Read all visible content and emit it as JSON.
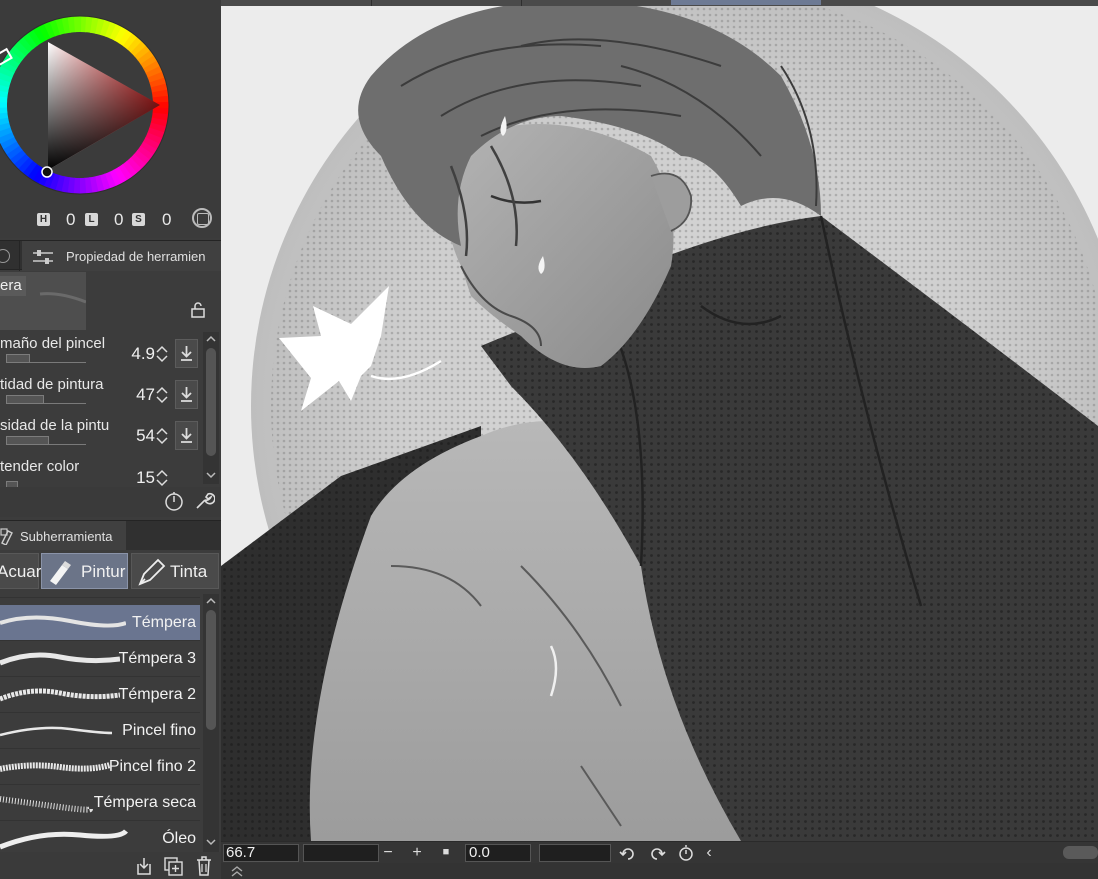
{
  "color_panel": {
    "hue_label": "H",
    "hue_value": "0",
    "lightness_label": "L",
    "lightness_value": "0",
    "saturation_label": "S",
    "saturation_value": "0"
  },
  "tool_property": {
    "tab_label": "Propiedad de herramien",
    "tool_name": "era",
    "properties": [
      {
        "label": "maño del pincel",
        "value": "4.9",
        "fill_fraction": 0.3
      },
      {
        "label": "tidad de pintura",
        "value": "47",
        "fill_fraction": 0.47
      },
      {
        "label": "sidad de la pintu",
        "value": "54",
        "fill_fraction": 0.54
      },
      {
        "label": "tender color",
        "value": "15",
        "fill_fraction": 0.15
      }
    ]
  },
  "subtool": {
    "tab_label": "Subherramienta",
    "groups": [
      {
        "label": "Acuar",
        "icon": "watercolor-icon",
        "active": false
      },
      {
        "label": "Pintur",
        "icon": "paint-tube-icon",
        "active": true
      },
      {
        "label": "Tinta",
        "icon": "ink-pen-icon",
        "active": false
      }
    ],
    "items": [
      {
        "name": "Témpera",
        "active": true
      },
      {
        "name": "Témpera 3",
        "active": false
      },
      {
        "name": "Témpera 2",
        "active": false
      },
      {
        "name": "Pincel fino",
        "active": false
      },
      {
        "name": "Pincel fino 2",
        "active": false
      },
      {
        "name": "Témpera seca",
        "active": false
      },
      {
        "name": "Óleo",
        "active": false
      }
    ]
  },
  "status_bar": {
    "zoom": "66.7",
    "zoom_out_symbol": "−",
    "zoom_in_symbol": "+",
    "fit_symbol": "■",
    "angle": "0.0",
    "collapse_symbol": "‹"
  },
  "colors": {
    "panel_bg": "#3c3c3c",
    "active_item": "#6a7590",
    "accent_red": "#e11f1f"
  }
}
